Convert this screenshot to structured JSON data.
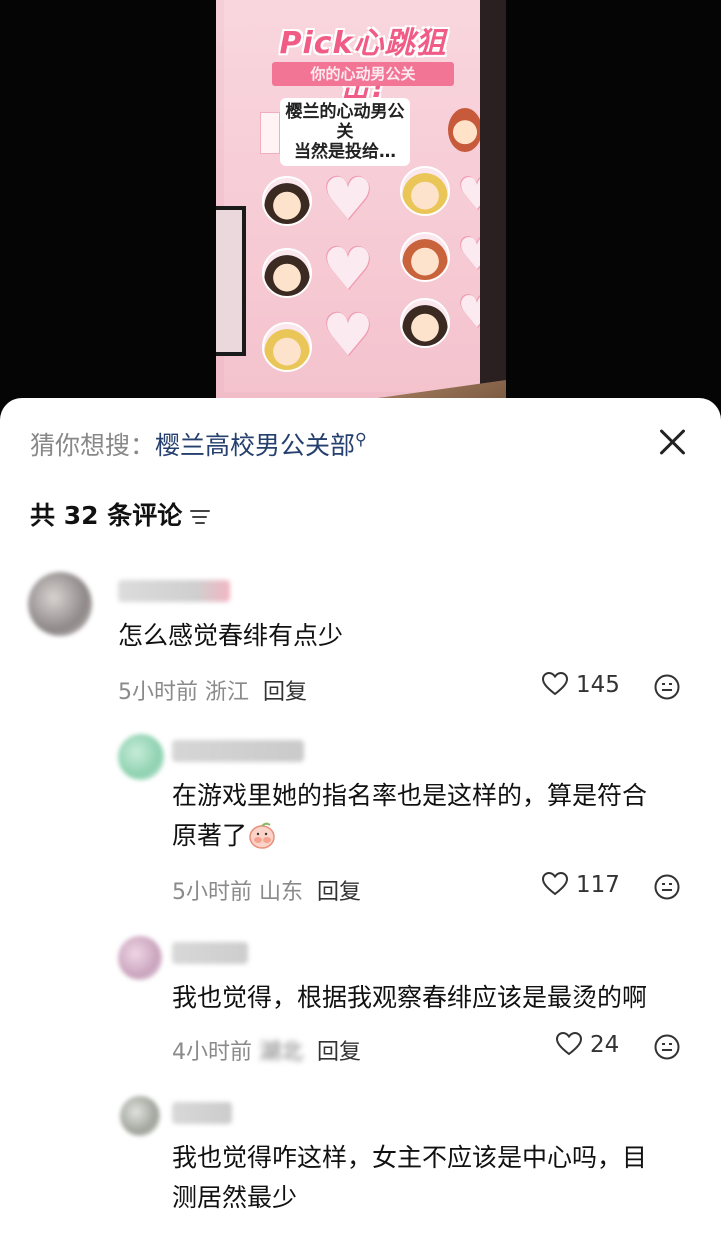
{
  "photo": {
    "banner_title": "Pick心跳狙击!",
    "banner_ribbon": "你的心动男公关",
    "caption_line1": "樱兰的心动男公关",
    "caption_line2": "当然是投给…"
  },
  "sheet": {
    "suggest_label": "猜你想搜：",
    "suggest_keyword": "樱兰高校男公关部",
    "comment_count_label": "共 32 条评论"
  },
  "comments": [
    {
      "text": "怎么感觉春绯有点少",
      "time": "5小时前",
      "location": "浙江",
      "reply_label": "回复",
      "likes": "145"
    },
    {
      "text_line1": "在游戏里她的指名率也是这样的，算是符合",
      "text_line2": "原著了",
      "time": "5小时前",
      "location": "山东",
      "reply_label": "回复",
      "likes": "117"
    },
    {
      "text": "我也觉得，根据我观察春绯应该是最烫的啊",
      "time": "4小时前",
      "location": "湖北",
      "reply_label": "回复",
      "likes": "24"
    },
    {
      "text_line1": "我也觉得咋这样，女主不应该是中心吗，目",
      "text_line2": "测居然最少"
    }
  ],
  "colors": {
    "keyword": "#25406e",
    "meta_gray": "#8a8a8a",
    "poster_pink": "#f4c3ce"
  }
}
